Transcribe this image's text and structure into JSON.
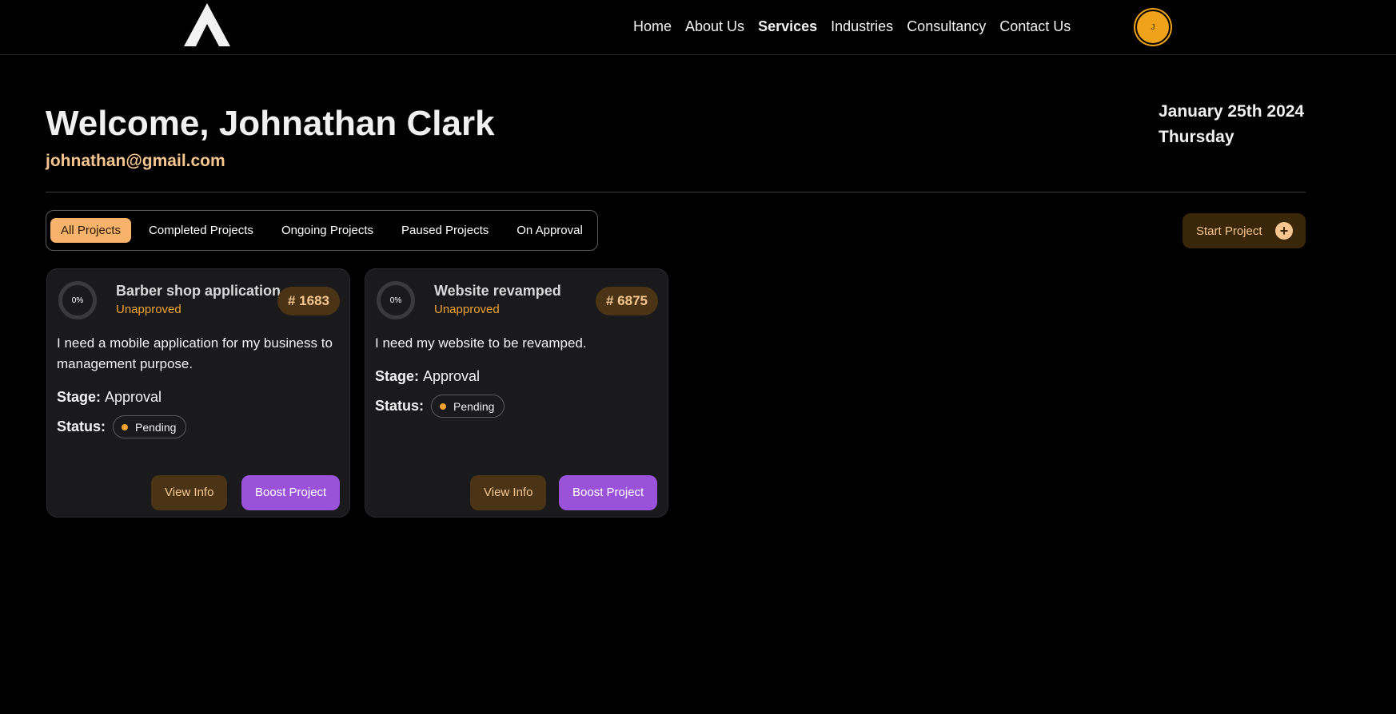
{
  "header": {
    "nav": [
      "Home",
      "About Us",
      "Services",
      "Industries",
      "Consultancy",
      "Contact Us"
    ],
    "active_nav": "Services",
    "avatar_initial": "J",
    "accent": "#f0a21a"
  },
  "welcome": {
    "title": "Welcome, Johnathan Clark",
    "email": "johnathan@gmail.com",
    "date": "January 25th 2024",
    "weekday": "Thursday"
  },
  "tabs": {
    "items": [
      "All Projects",
      "Completed Projects",
      "Ongoing Projects",
      "Paused Projects",
      "On Approval"
    ],
    "selected": "All Projects"
  },
  "start_project": {
    "label": "Start Project",
    "icon": "plus-icon"
  },
  "projects": [
    {
      "progress": "0%",
      "title": "Barber shop application",
      "approval": "Unapproved",
      "id": "# 1683",
      "description": "I need a mobile application for my business to management purpose.",
      "stage_label": "Stage:",
      "stage": "Approval",
      "status_label": "Status:",
      "status": "Pending",
      "view_label": "View Info",
      "boost_label": "Boost Project"
    },
    {
      "progress": "0%",
      "title": "Website revamped",
      "approval": "Unapproved",
      "id": "# 6875",
      "description": "I need my website to be revamped.",
      "stage_label": "Stage:",
      "stage": "Approval",
      "status_label": "Status:",
      "status": "Pending",
      "view_label": "View Info",
      "boost_label": "Boost Project"
    }
  ],
  "colors": {
    "background": "#000000",
    "card": "#1a1a1d",
    "boost": "#9a52db",
    "highlight": "#f7b26c",
    "pending_dot": "#f0a232"
  }
}
